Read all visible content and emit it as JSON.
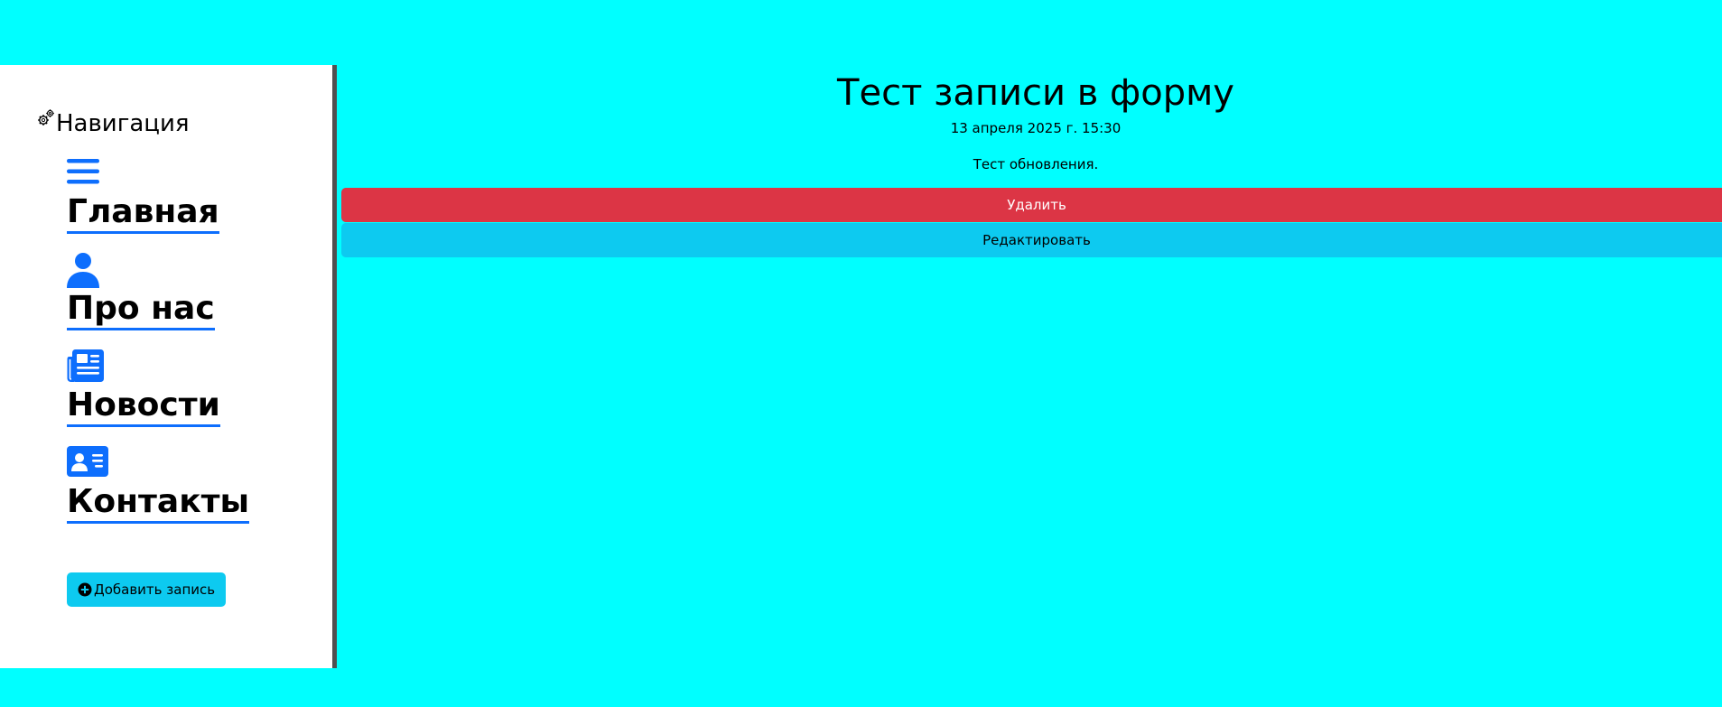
{
  "sidebar": {
    "title": "Навигация",
    "title_icon": "gears-icon",
    "items": [
      {
        "icon": "hamburger-menu-icon",
        "label": "Главная"
      },
      {
        "icon": "person-icon",
        "label": "Про нас"
      },
      {
        "icon": "newspaper-icon",
        "label": "Новости"
      },
      {
        "icon": "person-vcard-icon",
        "label": "Контакты"
      }
    ],
    "add_button": {
      "label": "Добавить запись",
      "icon": "plus-circle-icon"
    }
  },
  "post": {
    "title": "Тест записи в форму",
    "date": "13 апреля 2025 г. 15:30",
    "body": "Тест обновления.",
    "delete_label": "Удалить",
    "edit_label": "Редактировать"
  },
  "colors": {
    "page_bg": "#00ffff",
    "accent": "#0d6efd",
    "danger": "#dc3545",
    "info": "#0dcaf0"
  }
}
